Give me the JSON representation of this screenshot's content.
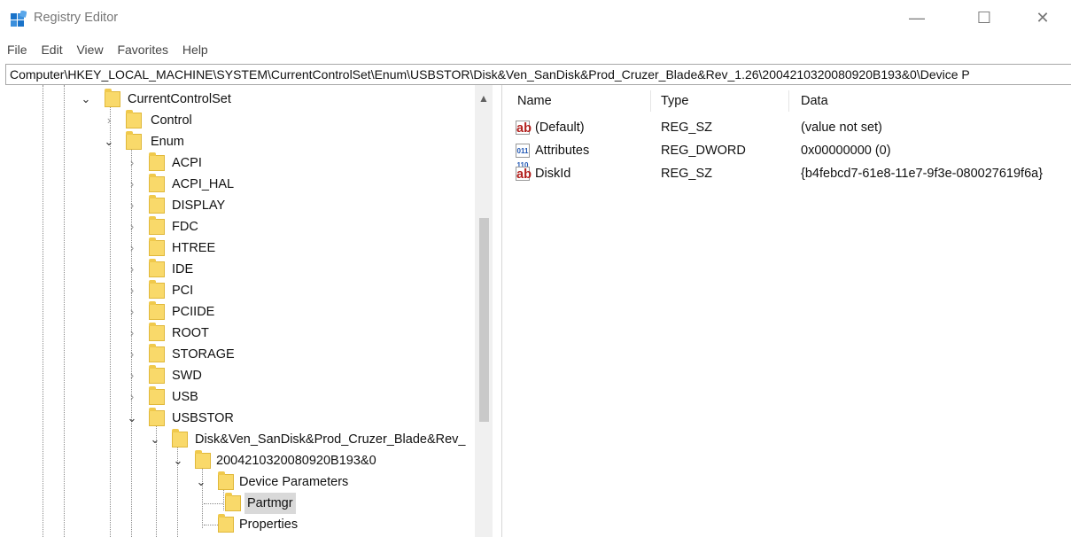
{
  "window": {
    "title": "Registry Editor",
    "controls": {
      "minimize": "—",
      "maximize": "☐",
      "close": "✕"
    }
  },
  "menu": [
    "File",
    "Edit",
    "View",
    "Favorites",
    "Help"
  ],
  "address": "Computer\\HKEY_LOCAL_MACHINE\\SYSTEM\\CurrentControlSet\\Enum\\USBSTOR\\Disk&Ven_SanDisk&Prod_Cruzer_Blade&Rev_1.26\\2004210320080920B193&0\\Device P",
  "tree": [
    {
      "label": "CurrentControlSet",
      "expanded": true
    },
    {
      "label": "Control",
      "expanded": false
    },
    {
      "label": "Enum",
      "expanded": true
    },
    {
      "label": "ACPI",
      "expanded": false
    },
    {
      "label": "ACPI_HAL",
      "expanded": false
    },
    {
      "label": "DISPLAY",
      "expanded": false
    },
    {
      "label": "FDC",
      "expanded": false
    },
    {
      "label": "HTREE",
      "expanded": false
    },
    {
      "label": "IDE",
      "expanded": false
    },
    {
      "label": "PCI",
      "expanded": false
    },
    {
      "label": "PCIIDE",
      "expanded": false
    },
    {
      "label": "ROOT",
      "expanded": false
    },
    {
      "label": "STORAGE",
      "expanded": false
    },
    {
      "label": "SWD",
      "expanded": false
    },
    {
      "label": "USB",
      "expanded": false
    },
    {
      "label": "USBSTOR",
      "expanded": true
    },
    {
      "label": "Disk&Ven_SanDisk&Prod_Cruzer_Blade&Rev_",
      "expanded": true
    },
    {
      "label": "2004210320080920B193&0",
      "expanded": true
    },
    {
      "label": "Device Parameters",
      "expanded": true
    },
    {
      "label": "Partmgr",
      "selected": true
    },
    {
      "label": "Properties"
    }
  ],
  "values_pane": {
    "headers": {
      "name": "Name",
      "type": "Type",
      "data": "Data"
    },
    "rows": [
      {
        "icon": "ab",
        "name": "(Default)",
        "type": "REG_SZ",
        "data": "(value not set)"
      },
      {
        "icon": "011\n110",
        "name": "Attributes",
        "type": "REG_DWORD",
        "data": "0x00000000 (0)"
      },
      {
        "icon": "ab",
        "name": "DiskId",
        "type": "REG_SZ",
        "data": "{b4febcd7-61e8-11e7-9f3e-080027619f6a}"
      }
    ]
  }
}
